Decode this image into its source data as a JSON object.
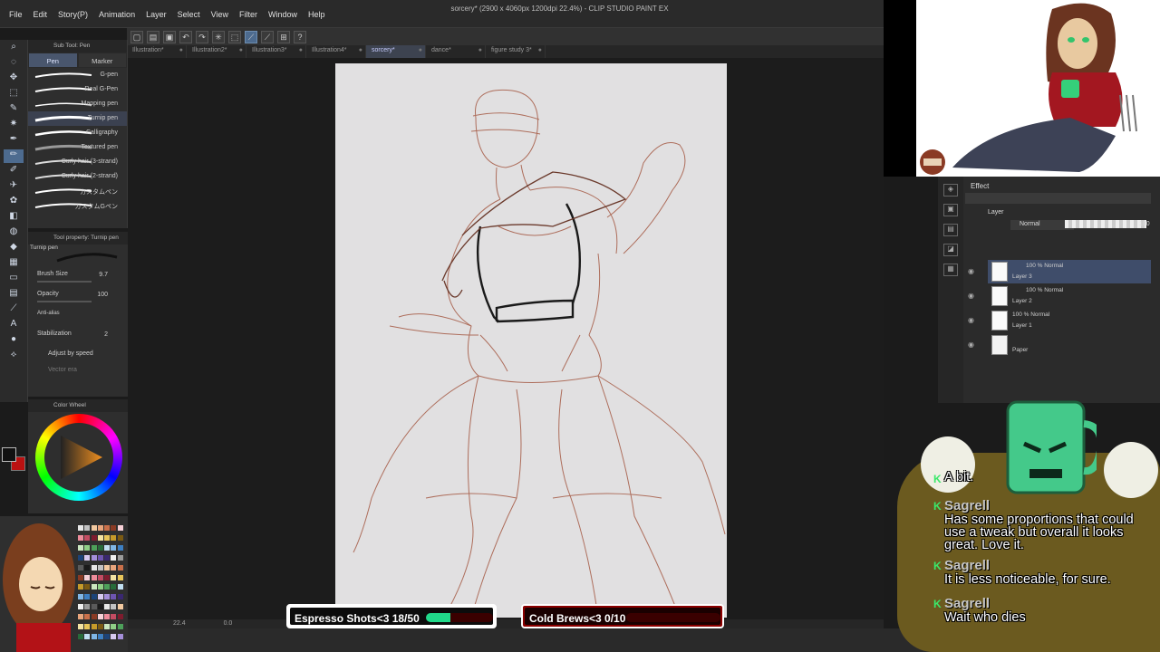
{
  "window": {
    "title": "sorcery* (2900 x 4060px 1200dpi 22.4%) - CLIP STUDIO PAINT EX"
  },
  "menu": [
    "File",
    "Edit",
    "Story(P)",
    "Animation",
    "Layer",
    "Select",
    "View",
    "Filter",
    "Window",
    "Help"
  ],
  "tabs": [
    {
      "label": "Illustration*",
      "active": false
    },
    {
      "label": "Illustration2*",
      "active": false
    },
    {
      "label": "Illustration3*",
      "active": false
    },
    {
      "label": "Illustration4*",
      "active": false
    },
    {
      "label": "sorcery*",
      "active": true
    },
    {
      "label": "dance*",
      "active": false
    },
    {
      "label": "figure study 3*",
      "active": false
    }
  ],
  "subtool": {
    "header": "Sub Tool: Pen",
    "tabs": [
      "Pen",
      "Marker"
    ],
    "brushes": [
      {
        "name": "G-pen",
        "selected": false
      },
      {
        "name": "Real G-Pen",
        "selected": false
      },
      {
        "name": "Mapping pen",
        "selected": false
      },
      {
        "name": "Turnip pen",
        "selected": true
      },
      {
        "name": "Calligraphy",
        "selected": false
      },
      {
        "name": "Textured pen",
        "selected": false
      },
      {
        "name": "Curly hair (3-strand)",
        "selected": false
      },
      {
        "name": "Curly hair (2-strand)",
        "selected": false
      },
      {
        "name": "カスタムペン",
        "selected": false
      },
      {
        "name": "カスタムGペン",
        "selected": false
      }
    ]
  },
  "toolprop": {
    "header": "Tool property: Turnip pen",
    "preview_label": "Turnip pen",
    "brush_size_label": "Brush Size",
    "brush_size": "9.7",
    "opacity_label": "Opacity",
    "opacity": "100",
    "antialias_label": "Anti-alias",
    "stabilization_label": "Stabilization",
    "stabilization": "2",
    "adjust_speed_label": "Adjust by speed",
    "vector_label": "Vector era"
  },
  "colorwheel": {
    "header": "Color Wheel",
    "readout": "0 0 0"
  },
  "canvas_status": {
    "zoom": "22.4",
    "rotation": "0.0"
  },
  "goals": [
    {
      "label": "Espresso Shots<3 18/50",
      "current": 18,
      "target": 50
    },
    {
      "label": "Cold Brews<3 0/10",
      "current": 0,
      "target": 10
    }
  ],
  "layers": {
    "effect_label": "Effect",
    "tab_label": "Layer",
    "blend_mode": "Normal",
    "opacity": "100",
    "items": [
      {
        "mode": "100 % Normal",
        "name": "Layer 3",
        "selected": true
      },
      {
        "mode": "100 % Normal",
        "name": "Layer 2",
        "selected": false
      },
      {
        "mode": "100 % Normal",
        "name": "Layer 1",
        "selected": false
      },
      {
        "mode": "",
        "name": "Paper",
        "selected": false
      }
    ]
  },
  "chat": [
    {
      "user": "Sagrell",
      "text": "A bit."
    },
    {
      "user": "Sagrell",
      "text": "Has some proportions that could use a tweak but overall it looks great. Love it."
    },
    {
      "user": "Sagrell",
      "text": "It is less noticeable, for sure."
    },
    {
      "user": "Sagrell",
      "text": "Wait who dies"
    }
  ],
  "colors": {
    "accent": "#4d6b8f",
    "goal_fill": "#20d98a",
    "goal_track": "#3a0000",
    "chat_badge": "#3be86a"
  }
}
